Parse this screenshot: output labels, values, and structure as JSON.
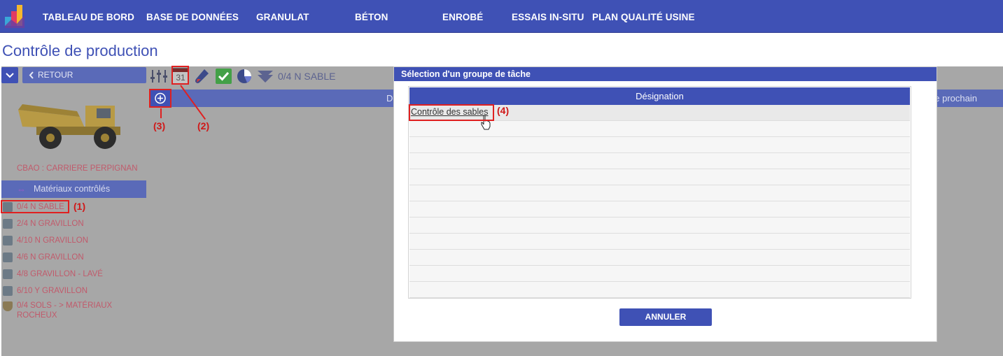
{
  "navbar": {
    "items": [
      {
        "label": "TABLEAU DE BORD"
      },
      {
        "label": "BASE DE DONNÉES"
      },
      {
        "label": "GRANULAT"
      },
      {
        "label": "BÉTON"
      },
      {
        "label": "ENROBÉ"
      },
      {
        "label": "ESSAIS IN-SITU"
      },
      {
        "label": "PLAN QUALITÉ USINE"
      }
    ]
  },
  "page": {
    "title": "Contrôle de production"
  },
  "sidebar": {
    "back_label": "RETOUR",
    "site_name": "CBAO : CARRIERE PERPIGNAN",
    "materials_header": "Matériaux contrôlés",
    "materials": [
      {
        "label": "0/4 N SABLE",
        "icon": "aggregate-icon"
      },
      {
        "label": "2/4 N GRAVILLON",
        "icon": "aggregate-icon"
      },
      {
        "label": "4/10 N GRAVILLON",
        "icon": "aggregate-icon"
      },
      {
        "label": "4/6 N GRAVILLON",
        "icon": "aggregate-icon"
      },
      {
        "label": "4/8 GRAVILLON - LAVÉ",
        "icon": "aggregate-icon"
      },
      {
        "label": "6/10 Y GRAVILLON",
        "icon": "aggregate-icon"
      },
      {
        "label": "0/4 SOLS - > MATÉRIAUX ROCHEUX",
        "icon": "shield-icon"
      }
    ]
  },
  "toolbar": {
    "material_title": "0/4 N SABLE",
    "calendar_day": "31",
    "icons": [
      "sliders-icon",
      "calendar-icon",
      "test-tube-icon",
      "check-icon",
      "pie-chart-icon",
      "funnel-icon"
    ]
  },
  "grid": {
    "header_left": "D",
    "header_right": "e prochain"
  },
  "annotations": [
    {
      "label": "(1)"
    },
    {
      "label": "(2)"
    },
    {
      "label": "(3)"
    },
    {
      "label": "(4)"
    }
  ],
  "modal": {
    "title": "Sélection d'un groupe de tâche",
    "column_header": "Désignation",
    "rows": [
      {
        "label": "Contrôle des sables"
      }
    ],
    "cancel_label": "ANNULER"
  },
  "colors": {
    "primary": "#3f51b5",
    "overlay": "#a7a7a7",
    "annotation": "#e02020",
    "material_text": "#c15a6b"
  }
}
